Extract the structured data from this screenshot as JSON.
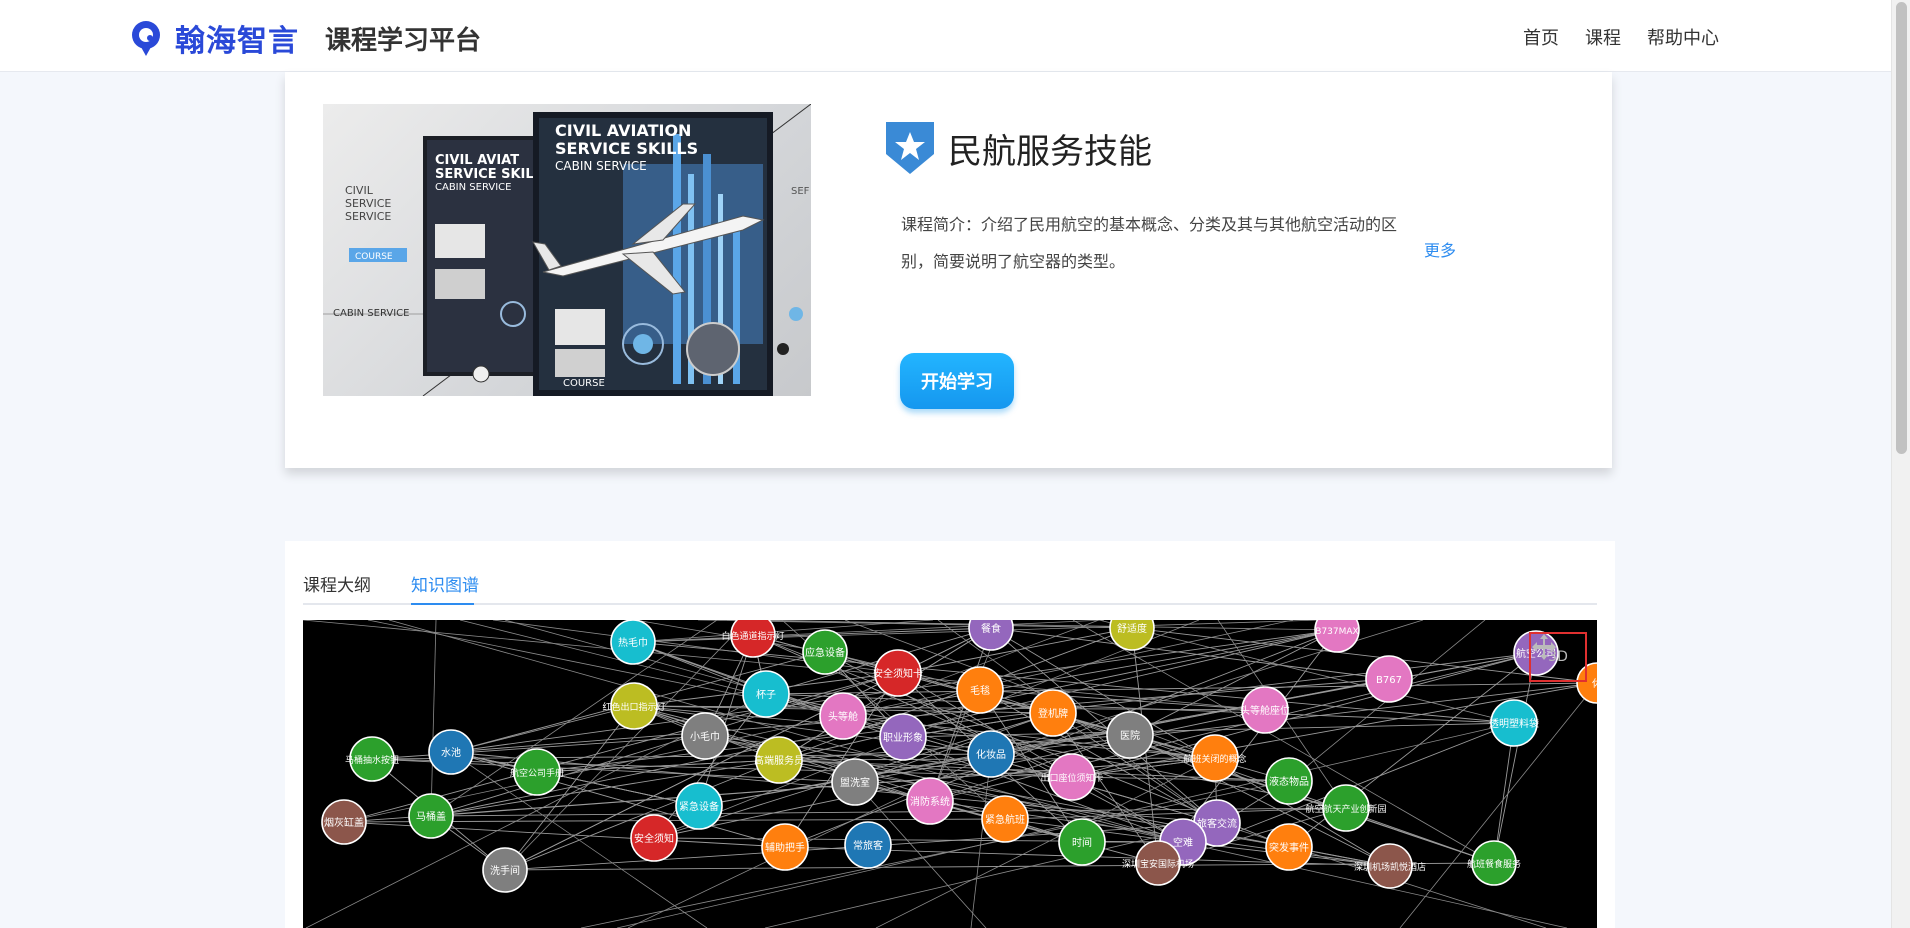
{
  "header": {
    "brand": "翰海智言",
    "platform_title": "课程学习平台",
    "nav": [
      {
        "label": "首页"
      },
      {
        "label": "课程"
      },
      {
        "label": "帮助中心"
      }
    ]
  },
  "course": {
    "title": "民航服务技能",
    "intro": "课程简介：介绍了民用航空的基本概念、分类及其与其他航空活动的区别，简要说明了航空器的类型。",
    "more_label": "更多",
    "start_button": "开始学习",
    "cover": {
      "main_title_lines": [
        "CIVIL AVIATION",
        "SERVICE SKILLS",
        "CABIN SERVICE"
      ],
      "back_title_lines": [
        "CIVIL AVIAT",
        "SERVICE SKILL",
        "CABIN SERVICE"
      ],
      "left_labels": [
        "CIVIL",
        "SERVICE",
        "SERVICE"
      ],
      "badge": "COURSE",
      "bottom_left": "CABIN SERVICE",
      "bottom_main": "COURSE",
      "right_partial": "SEF"
    }
  },
  "tabs": [
    {
      "label": "课程大纲",
      "active": false
    },
    {
      "label": "知识图谱",
      "active": true
    }
  ],
  "graph": {
    "toggle_3d_label": "3D",
    "nodes": [
      {
        "label": "热毛巾",
        "color": "#17becf"
      },
      {
        "label": "白色通道指示灯",
        "color": "#d62728"
      },
      {
        "label": "应急设备",
        "color": "#2ca02c"
      },
      {
        "label": "餐食",
        "color": "#9467bd"
      },
      {
        "label": "舒适度",
        "color": "#bcbd22"
      },
      {
        "label": "B737MAX",
        "color": "#e377c2"
      },
      {
        "label": "安全须知卡",
        "color": "#d62728"
      },
      {
        "label": "杯子",
        "color": "#17becf"
      },
      {
        "label": "毛毯",
        "color": "#ff7f0e"
      },
      {
        "label": "B767",
        "color": "#e377c2"
      },
      {
        "label": "红色出口指示灯",
        "color": "#bcbd22"
      },
      {
        "label": "头等舱",
        "color": "#e377c2"
      },
      {
        "label": "登机牌",
        "color": "#ff7f0e"
      },
      {
        "label": "头等舱座位",
        "color": "#e377c2"
      },
      {
        "label": "透明塑料袋",
        "color": "#17becf"
      },
      {
        "label": "小毛巾",
        "color": "#7f7f7f"
      },
      {
        "label": "职业形象",
        "color": "#9467bd"
      },
      {
        "label": "医院",
        "color": "#7f7f7f"
      },
      {
        "label": "水池",
        "color": "#1f77b4"
      },
      {
        "label": "马桶抽水按钮",
        "color": "#2ca02c"
      },
      {
        "label": "高端服务员",
        "color": "#bcbd22"
      },
      {
        "label": "化妆品",
        "color": "#1f77b4"
      },
      {
        "label": "航班关闭的概念",
        "color": "#ff7f0e"
      },
      {
        "label": "航空公司手册",
        "color": "#2ca02c"
      },
      {
        "label": "盥洗室",
        "color": "#7f7f7f"
      },
      {
        "label": "出口座位须知卡",
        "color": "#e377c2"
      },
      {
        "label": "液态物品",
        "color": "#2ca02c"
      },
      {
        "label": "紧急设备",
        "color": "#17becf"
      },
      {
        "label": "消防系统",
        "color": "#e377c2"
      },
      {
        "label": "紧急航班",
        "color": "#ff7f0e"
      },
      {
        "label": "旅客交流",
        "color": "#9467bd"
      },
      {
        "label": "航空航天产业创新园",
        "color": "#2ca02c"
      },
      {
        "label": "烟灰缸盖",
        "color": "#8c564b"
      },
      {
        "label": "马桶盖",
        "color": "#2ca02c"
      },
      {
        "label": "空难",
        "color": "#9467bd"
      },
      {
        "label": "安全须知",
        "color": "#d62728"
      },
      {
        "label": "辅助把手",
        "color": "#ff7f0e"
      },
      {
        "label": "常旅客",
        "color": "#1f77b4"
      },
      {
        "label": "时间",
        "color": "#2ca02c"
      },
      {
        "label": "突发事件",
        "color": "#ff7f0e"
      },
      {
        "label": "洗手间",
        "color": "#7f7f7f"
      },
      {
        "label": "深圳宝安国际机场",
        "color": "#8c564b"
      },
      {
        "label": "深圳机场凯悦酒店",
        "color": "#8c564b"
      },
      {
        "label": "航班餐食服务",
        "color": "#2ca02c"
      },
      {
        "label": "航空公司",
        "color": "#9467bd"
      },
      {
        "label": "休",
        "color": "#ff7f0e"
      }
    ]
  }
}
